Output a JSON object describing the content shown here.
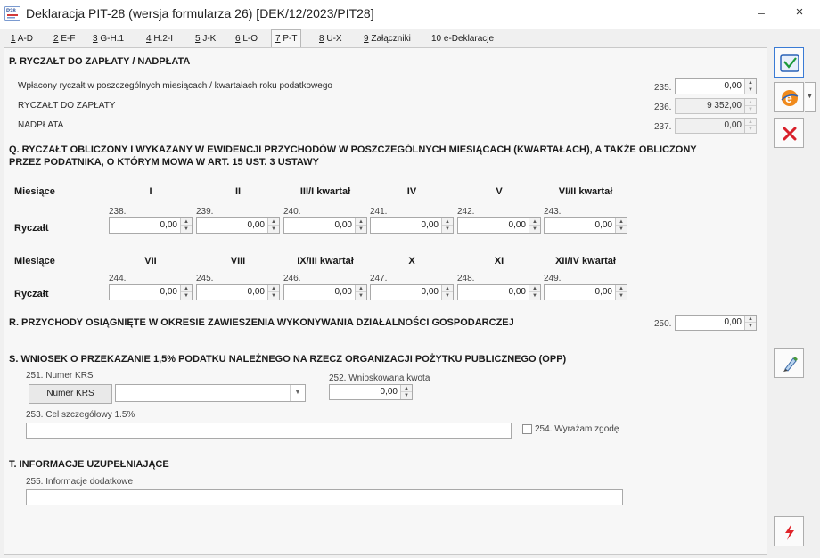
{
  "window": {
    "app_icon": "pit-form-icon",
    "app_icon_text": "P28",
    "title": "Deklaracja PIT-28 (wersja formularza 26) [DEK/12/2023/PIT28]",
    "minimize": "–",
    "close": "×"
  },
  "tabs": [
    {
      "key": "1",
      "label": " A-D"
    },
    {
      "key": "2",
      "label": " E-F"
    },
    {
      "key": "3",
      "label": " G-H.1"
    },
    {
      "key": "4",
      "label": " H.2-I"
    },
    {
      "key": "5",
      "label": " J-K"
    },
    {
      "key": "6",
      "label": " L-O"
    },
    {
      "key": "7",
      "label": " P-T"
    },
    {
      "key": "8",
      "label": " U-X"
    },
    {
      "key": "9",
      "label": " Załączniki"
    },
    {
      "key": "10",
      "label": " e-Deklaracje"
    }
  ],
  "active_tab": "7",
  "section_p": {
    "title": "P. RYCZAŁT DO ZAPŁATY / NADPŁATA",
    "rows": [
      {
        "label": "Wpłacony ryczałt w poszczególnych miesiącach / kwartałach roku podatkowego",
        "num": "235.",
        "value": "0,00",
        "enabled": true
      },
      {
        "label": "RYCZAŁT DO ZAPŁATY",
        "num": "236.",
        "value": "9 352,00",
        "enabled": false
      },
      {
        "label": "NADPŁATA",
        "num": "237.",
        "value": "0,00",
        "enabled": false
      }
    ]
  },
  "section_q": {
    "title_line1": "Q. RYCZAŁT OBLICZONY I WYKAZANY W EWIDENCJI PRZYCHODÓW W POSZCZEGÓLNYCH MIESIĄCACH (KWARTAŁACH), A TAKŻE OBLICZONY",
    "title_line2": "PRZEZ PODATNIKA, O KTÓRYM MOWA W ART. 15 UST. 3 USTAWY",
    "row_label_months": "Miesiące",
    "row_label_ryczalt": "Ryczałt",
    "group1": {
      "headers": [
        "I",
        "II",
        "III/I kwartał",
        "IV",
        "V",
        "VI/II kwartał"
      ],
      "nums": [
        "238.",
        "239.",
        "240.",
        "241.",
        "242.",
        "243."
      ],
      "values": [
        "0,00",
        "0,00",
        "0,00",
        "0,00",
        "0,00",
        "0,00"
      ]
    },
    "group2": {
      "headers": [
        "VII",
        "VIII",
        "IX/III kwartał",
        "X",
        "XI",
        "XII/IV kwartał"
      ],
      "nums": [
        "244.",
        "245.",
        "246.",
        "247.",
        "248.",
        "249."
      ],
      "values": [
        "0,00",
        "0,00",
        "0,00",
        "0,00",
        "0,00",
        "0,00"
      ]
    }
  },
  "section_r": {
    "title": "R. PRZYCHODY OSIĄGNIĘTE W OKRESIE ZAWIESZENIA WYKONYWANIA DZIAŁALNOŚCI GOSPODARCZEJ",
    "num": "250.",
    "value": "0,00"
  },
  "section_s": {
    "title": "S. WNIOSEK O PRZEKAZANIE 1,5% PODATKU NALEŻNEGO NA RZECZ ORGANIZACJI POŻYTKU PUBLICZNEGO (OPP)",
    "krs_label": "251. Numer KRS",
    "krs_button": "Numer KRS",
    "krs_value": "",
    "amount_label": "252. Wnioskowana kwota",
    "amount_value": "0,00",
    "goal_label": "253. Cel szczegółowy 1.5%",
    "goal_value": "",
    "consent_label": "254. Wyrażam zgodę",
    "consent_checked": false
  },
  "section_t": {
    "title": "T. INFORMACJE UZUPEŁNIAJĄCE",
    "info_label": "255. Informacje dodatkowe",
    "info_value": ""
  },
  "sidebar": {
    "save_icon": "save-icon",
    "edeclaration_icon": "e-declaration-icon",
    "cancel_icon": "cancel-icon",
    "edit_icon": "edit-pen-icon",
    "lightning_icon": "lightning-icon"
  }
}
